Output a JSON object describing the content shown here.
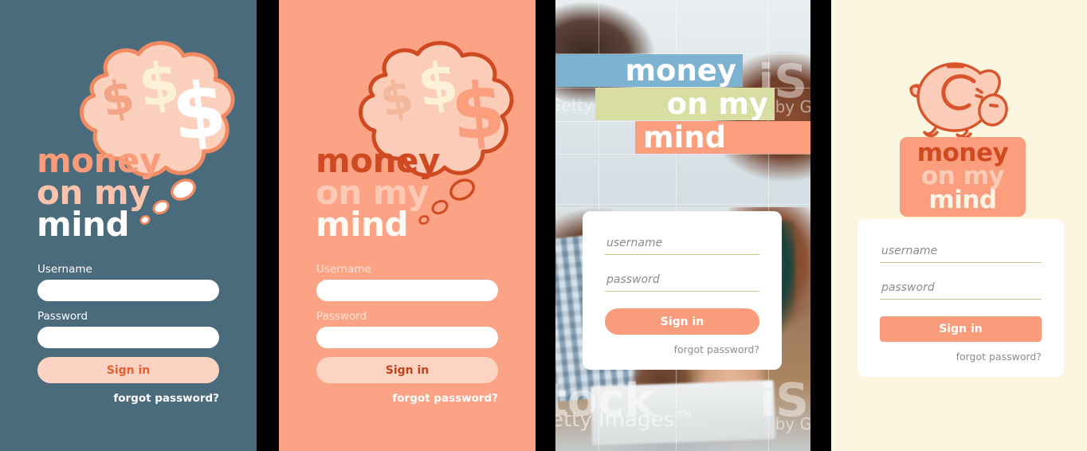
{
  "brand": {
    "line1": "money",
    "line2": "on my",
    "line3": "mind"
  },
  "colors": {
    "slate_bg": "#4a6b7c",
    "salmon_bg": "#fca386",
    "cream_bg": "#fcf6e0",
    "accent_salmon": "#fa9e7e",
    "accent_rust": "#cf4a20",
    "button_pale": "#fcd3c2",
    "band_blue": "#7eb2d1",
    "band_olive": "#d8dda2",
    "band_salmon": "#fa9e7e",
    "input_underline": "#c6c68c",
    "white": "#ffffff"
  },
  "panels": [
    {
      "id": "slate",
      "style": "block-form",
      "logo": "thought-bubble-with-dollar-signs",
      "username_label": "Username",
      "password_label": "Password",
      "username_value": "",
      "password_value": "",
      "username_placeholder": "",
      "password_placeholder": "",
      "signin_label": "Sign in",
      "forgot_label": "forgot password?"
    },
    {
      "id": "salmon",
      "style": "block-form",
      "logo": "thought-bubble-with-dollar-signs",
      "username_label": "Username",
      "password_label": "Password",
      "username_value": "",
      "password_value": "",
      "username_placeholder": "",
      "password_placeholder": "",
      "signin_label": "Sign in",
      "forgot_label": "forgot password?"
    },
    {
      "id": "photo",
      "style": "card-form",
      "logo": "color-band-wordmark",
      "username_label": "",
      "password_label": "",
      "username_value": "",
      "password_value": "",
      "username_placeholder": "username",
      "password_placeholder": "password",
      "signin_label": "Sign in",
      "forgot_label": "forgot password?",
      "watermarks": {
        "getty_top": "Getty I",
        "by_getty_top": "by G",
        "is_top": "iS",
        "istock_bottom": "tock",
        "getty_bottom": "etty Images™",
        "is_bottom": "iS",
        "by_getty_bottom": "by G"
      }
    },
    {
      "id": "cream",
      "style": "card-form",
      "logo": "piggy-bank",
      "username_label": "",
      "password_label": "",
      "username_value": "",
      "password_value": "",
      "username_placeholder": "username",
      "password_placeholder": "password",
      "signin_label": "Sign in",
      "forgot_label": "forgot password?"
    }
  ]
}
